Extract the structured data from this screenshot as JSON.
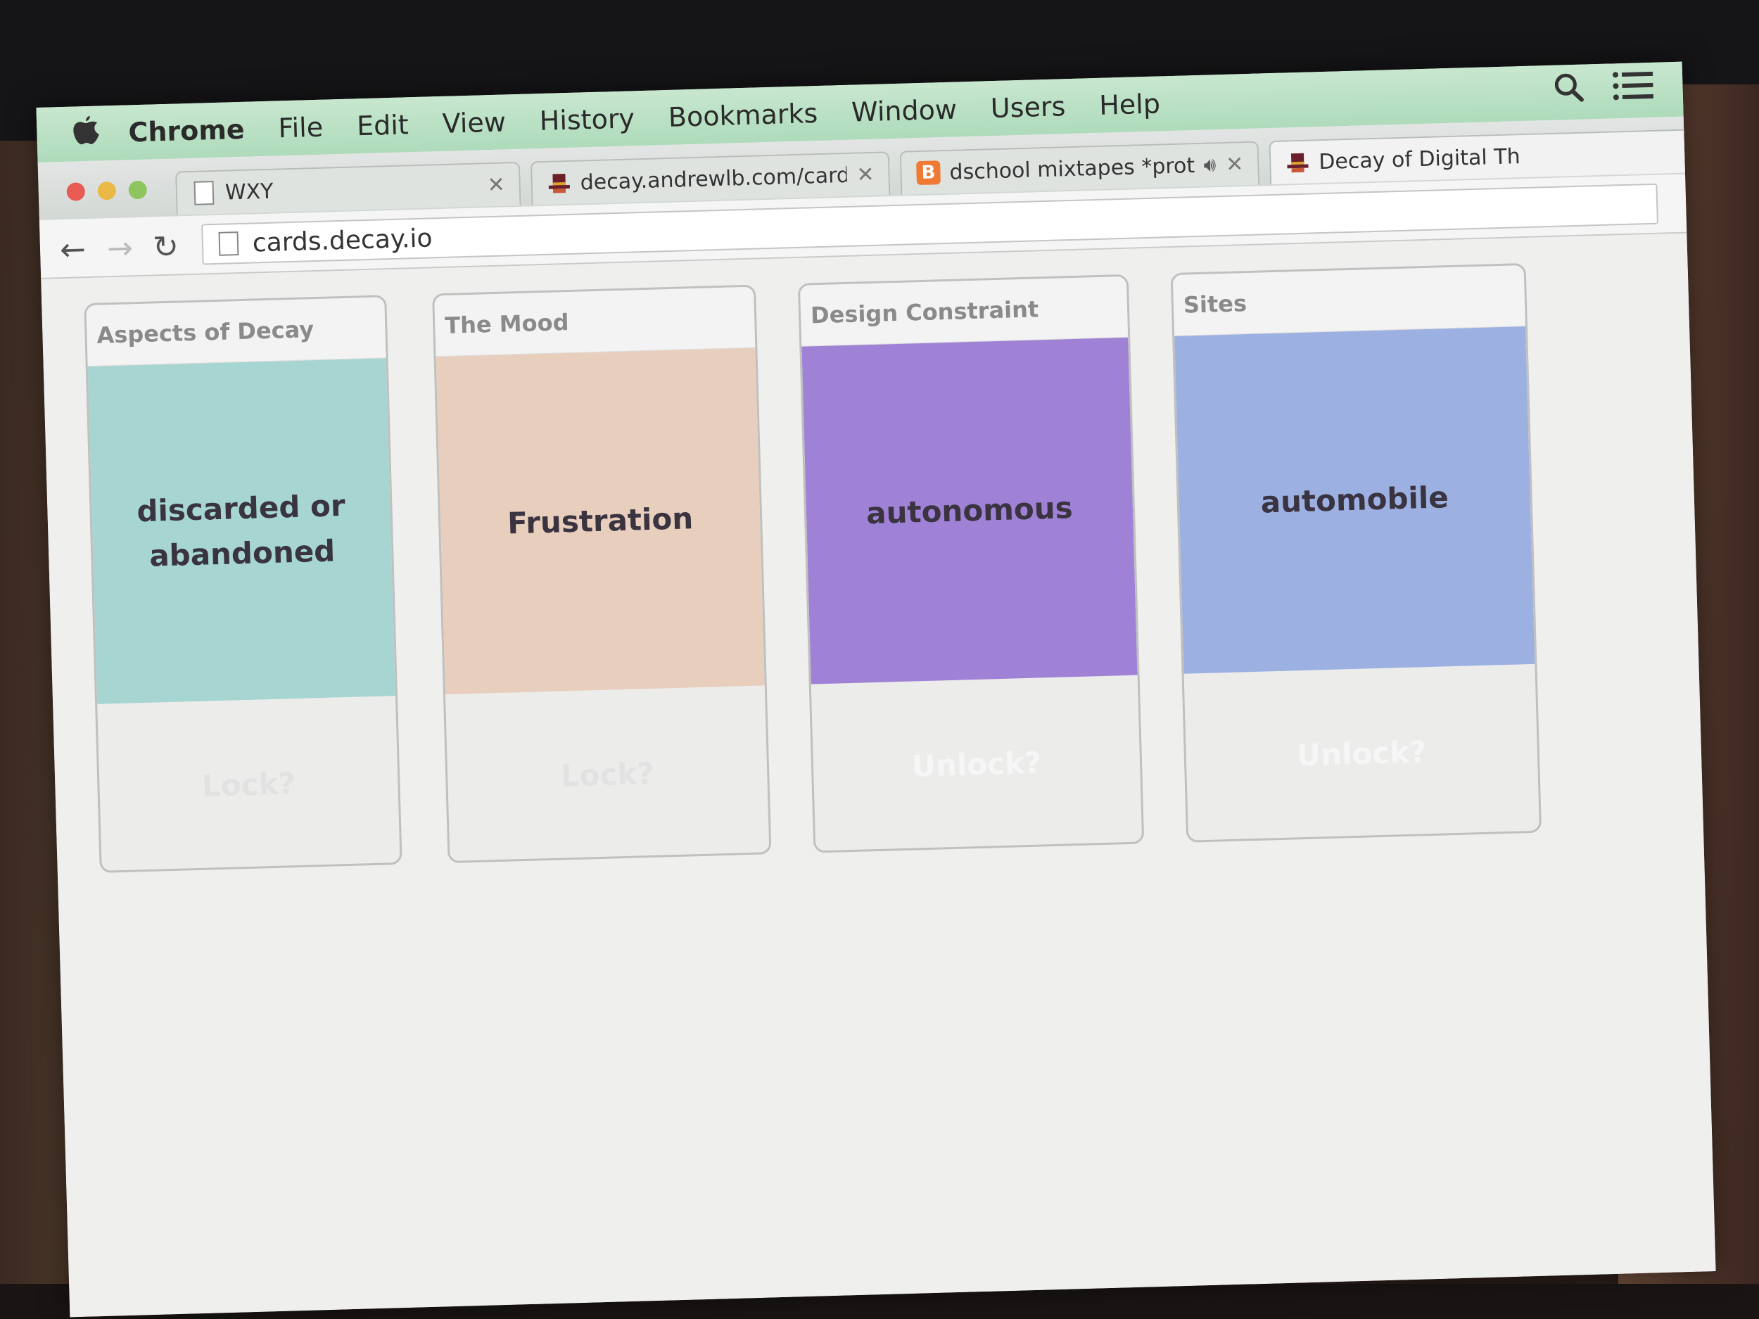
{
  "menubar": {
    "items": [
      "Chrome",
      "File",
      "Edit",
      "View",
      "History",
      "Bookmarks",
      "Window",
      "Users",
      "Help"
    ]
  },
  "tabs": [
    {
      "title": "WXY",
      "icon": "page-icon"
    },
    {
      "title": "decay.andrewlb.com/card",
      "icon": "hat-icon"
    },
    {
      "title": "dschool mixtapes *prot",
      "icon": "blogger-icon"
    },
    {
      "title": "Decay of Digital Th",
      "icon": "hat-icon"
    }
  ],
  "toolbar": {
    "back": "←",
    "forward": "→",
    "reload": "↻",
    "url": "cards.decay.io"
  },
  "cards": [
    {
      "category": "Aspects of Decay",
      "value": "discarded or abandoned",
      "action": "Lock?",
      "color": "#a6d5d2"
    },
    {
      "category": "The Mood",
      "value": "Frustration",
      "action": "Lock?",
      "color": "#e8cebc"
    },
    {
      "category": "Design Constraint",
      "value": "autonomous",
      "action": "Unlock?",
      "color": "#9f82d6"
    },
    {
      "category": "Sites",
      "value": "automobile",
      "action": "Unlock?",
      "color": "#9cb1e2"
    }
  ]
}
